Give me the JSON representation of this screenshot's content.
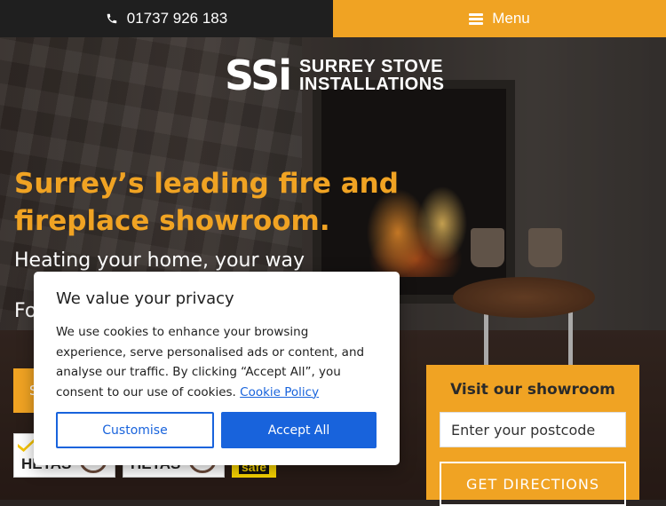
{
  "topbar": {
    "phone": "01737 926 183",
    "phone_icon": "phone-icon",
    "menu_label": "Menu",
    "menu_icon": "hamburger-icon"
  },
  "logo": {
    "mark": "SSi",
    "line1": "SURREY STOVE",
    "line2": "INSTALLATIONS"
  },
  "hero": {
    "headline": "Surrey’s leading fire and fireplace showroom.",
    "subheading": "Heating your home, your way",
    "subheading2": "Fo",
    "cta_partial": "S"
  },
  "badges": [
    {
      "label": "HETAS"
    },
    {
      "label": "HETAS"
    },
    {
      "label": "safe"
    }
  ],
  "showroom": {
    "title": "Visit our showroom",
    "postcode_placeholder": "Enter your postcode",
    "button": "GET DIRECTIONS"
  },
  "cookie": {
    "title": "We value your privacy",
    "body": "We use cookies to enhance your browsing experience, serve personalised ads or content, and analyse our traffic. By clicking “Accept All”, you consent to our use of cookies. ",
    "link": "Cookie Policy",
    "customise": "Customise",
    "accept": "Accept All"
  },
  "colors": {
    "accent": "#f0a323",
    "dark": "#1f1f1f",
    "cookie_blue": "#1863dc"
  }
}
